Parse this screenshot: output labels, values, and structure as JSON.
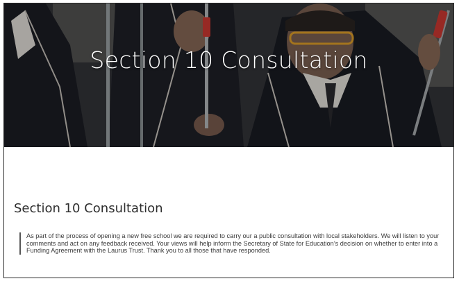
{
  "hero": {
    "title": "Section 10 Consultation",
    "image": "science-lab-students-photo"
  },
  "content": {
    "heading": "Section 10 Consultation",
    "paragraph": "As part of the process of opening a new free school we are required to carry our a public consultation with local stakeholders. We will listen to your comments and act on any feedback received. Your views will help inform the Secretary of State for Education’s decision on whether to enter into a Funding Agreement with the Laurus Trust.  Thank you to all those that have responded."
  },
  "colors": {
    "hero_dark": "#2a2b2f",
    "text": "#3a3a3a",
    "quote_border": "#555555",
    "pipette_red": "#d23a32",
    "goggles_orange": "#e2a12a"
  }
}
